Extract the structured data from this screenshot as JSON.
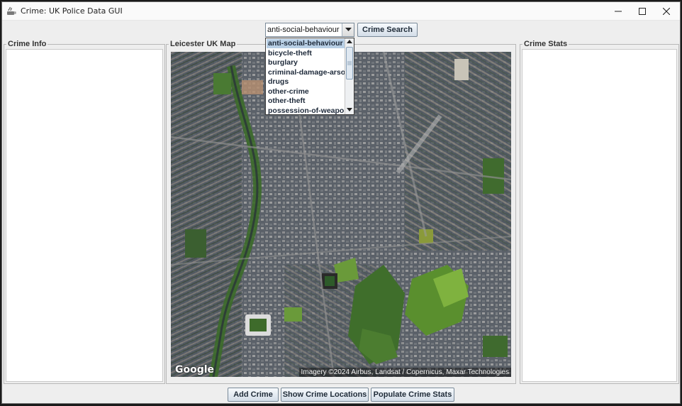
{
  "window": {
    "title": "Crime: UK Police Data GUI",
    "controls": {
      "minimize": "minimize-icon",
      "maximize": "maximize-icon",
      "close": "close-icon"
    }
  },
  "toolbar": {
    "crime_type_selected": "anti-social-behaviour",
    "search_label": "Crime Search"
  },
  "dropdown": {
    "options": [
      "anti-social-behaviour",
      "bicycle-theft",
      "burglary",
      "criminal-damage-arson",
      "drugs",
      "other-crime",
      "other-theft",
      "possession-of-weapons"
    ],
    "selected_index": 0
  },
  "panels": {
    "left_title": "Crime Info",
    "center_title": "Leicester UK Map",
    "right_title": "Crime Stats"
  },
  "map": {
    "logo": "Google",
    "attribution": "Imagery ©2024 Airbus, Landsat / Copernicus, Maxar Technologies"
  },
  "bottom_buttons": {
    "add_crime": "Add Crime",
    "show_locations": "Show Crime Locations",
    "populate_stats": "Populate Crime Stats"
  },
  "colors": {
    "window_bg": "#eeeeee",
    "selection": "#b8cfe5",
    "button_border": "#7a8a99"
  }
}
